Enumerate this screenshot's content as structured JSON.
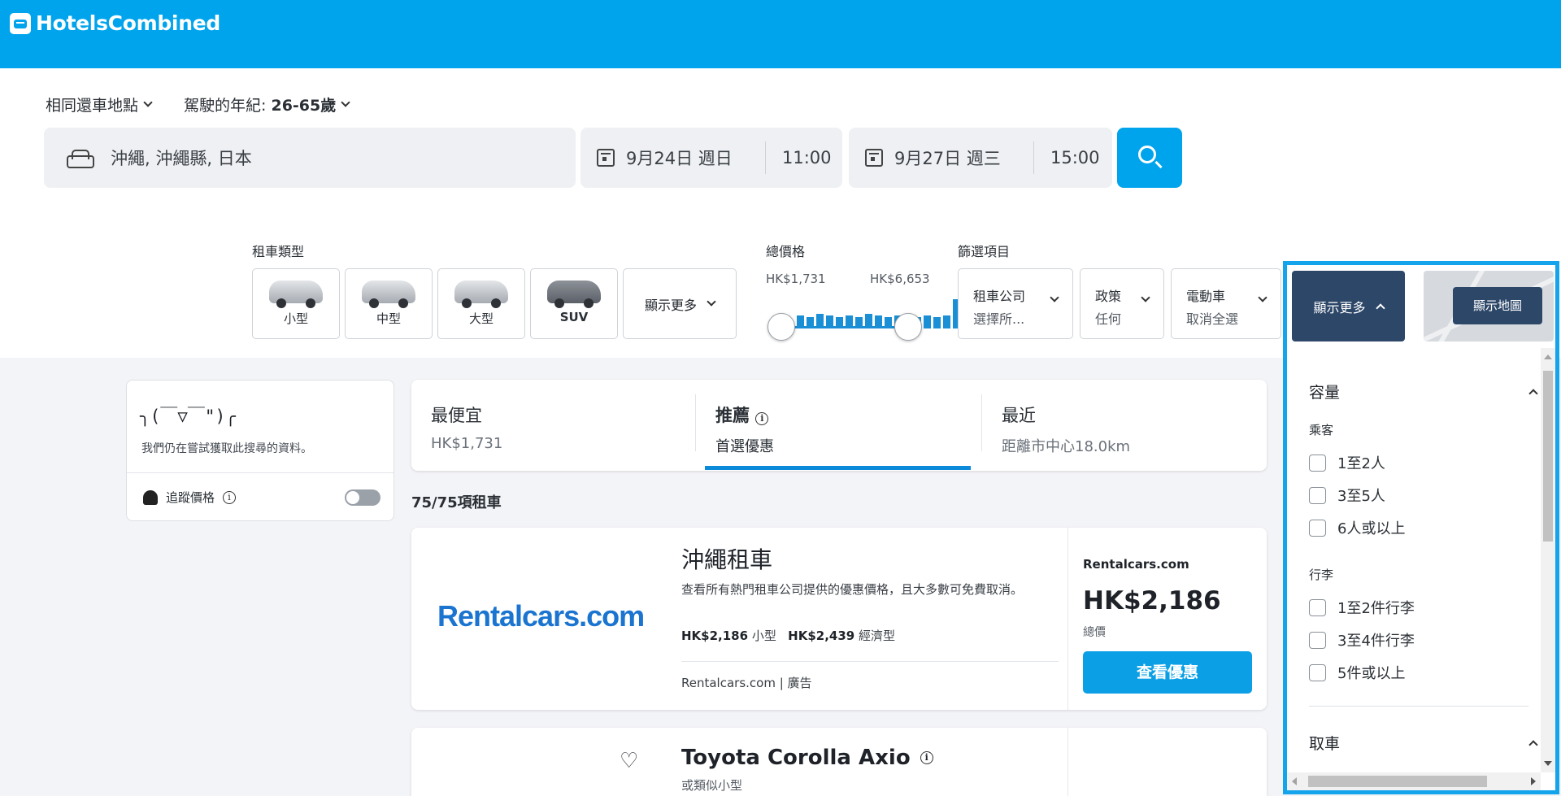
{
  "brand": {
    "name": "HotelsCombined"
  },
  "search_options": {
    "return_location": "相同還車地點",
    "age_label": "駕駛的年紀: ",
    "age_value": "26-65歲"
  },
  "search": {
    "location": "沖繩, 沖繩縣, 日本",
    "pickup_date": "9月24日 週日",
    "pickup_time": "11:00",
    "dropoff_date": "9月27日 週三",
    "dropoff_time": "15:00"
  },
  "car_types": {
    "label": "租車類型",
    "items": [
      "小型",
      "中型",
      "大型",
      "SUV"
    ],
    "more_label": "顯示更多"
  },
  "price_filter": {
    "label": "總價格",
    "min": "HK$1,731",
    "max": "HK$6,653",
    "histogram": [
      0.4,
      0.35,
      0.45,
      0.4,
      0.35,
      0.4,
      0.35,
      0.45,
      0.4,
      0.35,
      0.4,
      0.45,
      0.35,
      0.4,
      0.35,
      0.4,
      0.9
    ]
  },
  "filters": {
    "label": "篩選項目",
    "rental_company": {
      "title": "租車公司",
      "value": "選擇所..."
    },
    "policy": {
      "title": "政策",
      "value": "任何"
    },
    "ev": {
      "title": "電動車",
      "value": "取消全選"
    }
  },
  "left_panel": {
    "emoticon": "╮(￣▽￣\")╭",
    "message": "我們仍在嘗試獲取此搜尋的資料。",
    "track_price": "追蹤價格",
    "track_enabled": false
  },
  "sort_tabs": [
    {
      "title": "最便宜",
      "sub": "HK$1,731"
    },
    {
      "title": "推薦",
      "sub": "首選優惠"
    },
    {
      "title": "最近",
      "sub": "距離市中心18.0km"
    }
  ],
  "results_count": "75/75項租車",
  "results": [
    {
      "logo": "Rentalcars.com",
      "title": "沖繩租車",
      "desc": "查看所有熱門租車公司提供的優惠價格，且大多數可免費取消。",
      "price_small": "HK$2,186",
      "small_label": "小型",
      "price_economy": "HK$2,439",
      "economy_label": "經濟型",
      "source": "Rentalcars.com",
      "ad_label": "廣告",
      "provider": "Rentalcars.com",
      "price": "HK$2,186",
      "total_label": "總價",
      "deal_button": "查看優惠"
    },
    {
      "title": "Toyota Corolla Axio",
      "sub": "或類似小型"
    }
  ],
  "right_panel": {
    "more_label": "顯示更多",
    "map_button": "顯示地圖",
    "sections": {
      "capacity": "容量",
      "passengers": "乘客",
      "passenger_options": [
        "1至2人",
        "3至5人",
        "6人或以上"
      ],
      "luggage": "行李",
      "luggage_options": [
        "1至2件行李",
        "3至4件行李",
        "5件或以上"
      ],
      "pickup": "取車"
    }
  },
  "colors": {
    "header": "#00a4ec",
    "accent": "#0ba0e6",
    "dark_button": "#2d4769",
    "panel_border": "#13a4ec"
  }
}
